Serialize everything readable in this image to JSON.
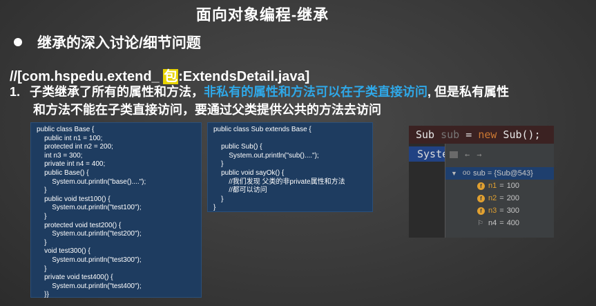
{
  "slide": {
    "title": "面向对象编程-继承",
    "bullet": "继承的深入讨论/细节问题",
    "path_prefix": "//[com.hspedu.extend_ ",
    "path_highlight": "包",
    "path_suffix": ":ExtendsDetail.java]",
    "point_number": "1.",
    "point_part1": "子类继承了所有的属性和方法，",
    "point_blue": "非私有的属性和方法可以在子类直接访问",
    "point_part2": ", 但是私有属性",
    "point_line2": "和方法不能在子类直接访问，要通过父类提供公共的方法去访问"
  },
  "code": {
    "base": "public class Base {\n    public int n1 = 100;\n    protected int n2 = 200;\n    int n3 = 300;\n    private int n4 = 400;\n    public Base() {\n        System.out.println(\"base()....\");\n    }\n    public void test100() {\n        System.out.println(\"test100\");\n    }\n    protected void test200() {\n        System.out.println(\"test200\");\n    }\n    void test300() {\n        System.out.println(\"test300\");\n    }\n    private void test400() {\n        System.out.println(\"test400\");\n    }}",
    "sub": "public class Sub extends Base {\n\n    public Sub() {\n        System.out.println(\"sub()....\");\n    }\n    public void sayOk() {\n        //我们发现 父类的非private属性和方法\n        //都可以访问\n    }\n}"
  },
  "ide": {
    "code_type": "Sub ",
    "code_var": "sub",
    "code_eq": " = ",
    "code_new": "new",
    "code_ctor": " Sub();",
    "hint": "Syste",
    "root_label": "sub = {Sub@543}",
    "fields": [
      {
        "name": "n1",
        "value": "100",
        "icon": "f"
      },
      {
        "name": "n2",
        "value": "200",
        "icon": "f"
      },
      {
        "name": "n3",
        "value": "300",
        "icon": "f"
      },
      {
        "name": "n4",
        "value": "400",
        "icon": "flag"
      }
    ]
  },
  "colors": {
    "accent_blue": "#2fa8e8",
    "highlight_yellow": "#e8d400",
    "code_bg": "#1e3c60"
  }
}
